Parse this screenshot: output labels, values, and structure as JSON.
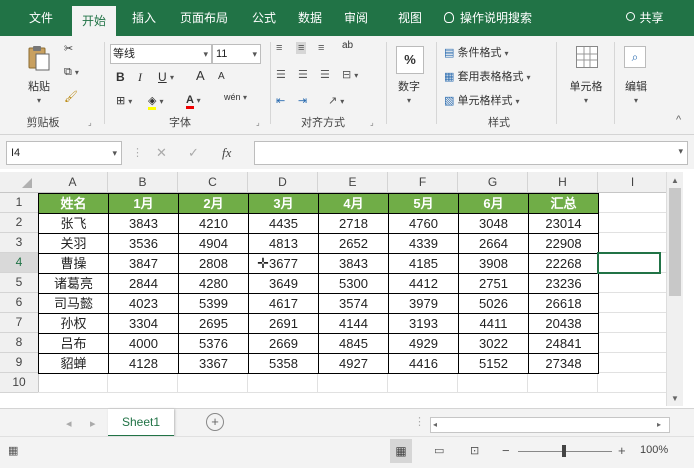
{
  "tabs": [
    "文件",
    "开始",
    "插入",
    "页面布局",
    "公式",
    "数据",
    "审阅",
    "视图"
  ],
  "active_tab": "开始",
  "tell_me": "操作说明搜索",
  "share": "共享",
  "ribbon": {
    "clipboard": {
      "paste": "粘贴",
      "label": "剪贴板"
    },
    "font": {
      "name": "等线",
      "size": "11",
      "bold": "B",
      "italic": "I",
      "underline": "U",
      "grow": "A",
      "shrink": "A",
      "color_a": "A",
      "phonetic": "wén",
      "label": "字体"
    },
    "alignment": {
      "wrap": "ab",
      "label": "对齐方式"
    },
    "number": {
      "percent": "%",
      "label": "数字"
    },
    "styles": {
      "conditional": "条件格式",
      "table": "套用表格格式",
      "cell": "单元格样式",
      "label": "样式"
    },
    "cells": {
      "label": "单元格"
    },
    "editing": {
      "label": "编辑"
    }
  },
  "name_box": "I4",
  "fx": "fx",
  "columns": [
    "A",
    "B",
    "C",
    "D",
    "E",
    "F",
    "G",
    "H",
    "I"
  ],
  "row_numbers": [
    "1",
    "2",
    "3",
    "4",
    "5",
    "6",
    "7",
    "8",
    "9",
    "10"
  ],
  "table": {
    "header": [
      "姓名",
      "1月",
      "2月",
      "3月",
      "4月",
      "5月",
      "6月",
      "汇总"
    ],
    "rows": [
      [
        "张飞",
        "3843",
        "4210",
        "4435",
        "2718",
        "4760",
        "3048",
        "23014"
      ],
      [
        "关羽",
        "3536",
        "4904",
        "4813",
        "2652",
        "4339",
        "2664",
        "22908"
      ],
      [
        "曹操",
        "3847",
        "2808",
        "3677",
        "3843",
        "4185",
        "3908",
        "22268"
      ],
      [
        "诸葛亮",
        "2844",
        "4280",
        "3649",
        "5300",
        "4412",
        "2751",
        "23236"
      ],
      [
        "司马懿",
        "4023",
        "5399",
        "4617",
        "3574",
        "3979",
        "5026",
        "26618"
      ],
      [
        "孙权",
        "3304",
        "2695",
        "2691",
        "4144",
        "3193",
        "4411",
        "20438"
      ],
      [
        "吕布",
        "4000",
        "5376",
        "2669",
        "4845",
        "4929",
        "3022",
        "24841"
      ],
      [
        "貂蝉",
        "4128",
        "3367",
        "5358",
        "4927",
        "4416",
        "5152",
        "27348"
      ]
    ]
  },
  "sheet_tab": "Sheet1",
  "zoom": "100%",
  "colors": {
    "excel_green": "#217346",
    "header_fill": "#70ad47"
  }
}
